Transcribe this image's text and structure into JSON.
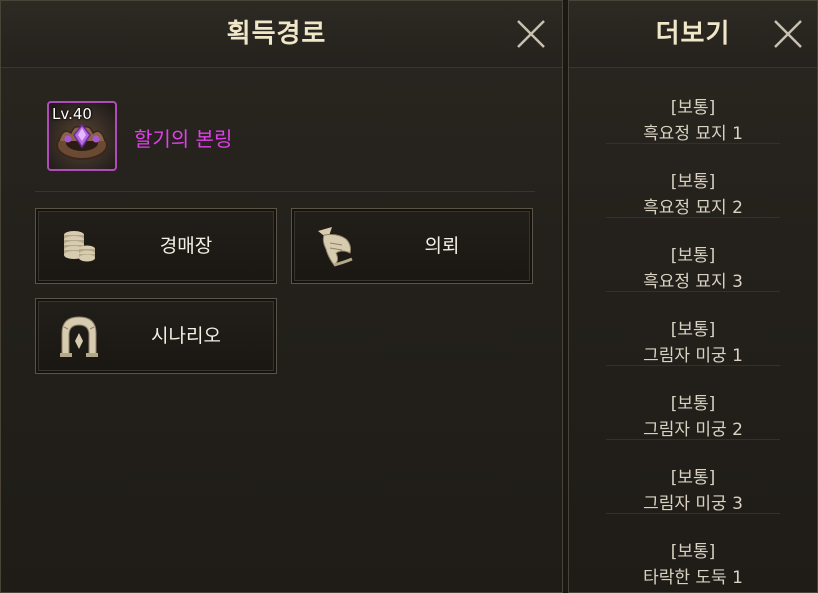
{
  "acquire_panel": {
    "title": "획득경로",
    "item": {
      "level": "Lv.40",
      "name": "할기의 본링"
    },
    "sources": [
      {
        "label": "경매장",
        "icon": "coins-icon"
      },
      {
        "label": "의뢰",
        "icon": "scroll-quill-icon"
      },
      {
        "label": "시나리오",
        "icon": "gate-arch-icon"
      }
    ]
  },
  "more_panel": {
    "title": "더보기",
    "items": [
      {
        "grade": "[보통]",
        "place": "흑요정 묘지 1"
      },
      {
        "grade": "[보통]",
        "place": "흑요정 묘지 2"
      },
      {
        "grade": "[보통]",
        "place": "흑요정 묘지 3"
      },
      {
        "grade": "[보통]",
        "place": "그림자 미궁 1"
      },
      {
        "grade": "[보통]",
        "place": "그림자 미궁 2"
      },
      {
        "grade": "[보통]",
        "place": "그림자 미궁 3"
      },
      {
        "grade": "[보통]",
        "place": "타락한 도둑 1"
      }
    ]
  },
  "colors": {
    "item_name": "#e040e8",
    "item_border": "#b04cb8",
    "title": "#f0e6c8"
  }
}
